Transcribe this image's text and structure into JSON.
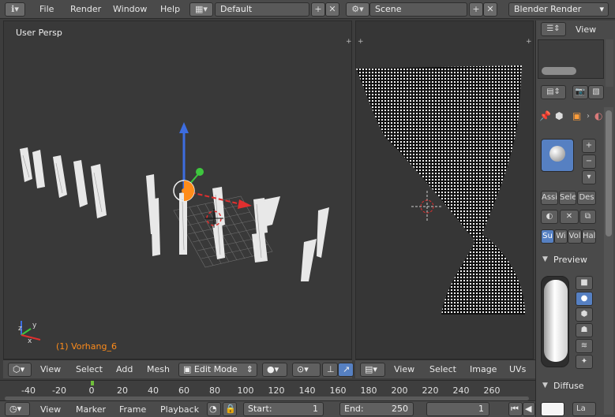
{
  "topbar": {
    "menu": [
      "File",
      "Render",
      "Window",
      "Help"
    ],
    "layout_name": "Default",
    "scene_name": "Scene",
    "render_engine": "Blender Render"
  },
  "view3d": {
    "label": "User Persp",
    "object_label": "(1) Vorhang_6",
    "header": {
      "menus": [
        "View",
        "Select",
        "Add",
        "Mesh"
      ],
      "mode": "Edit Mode"
    }
  },
  "uv_editor": {
    "header": {
      "menus": [
        "View",
        "Select",
        "Image",
        "UVs"
      ]
    }
  },
  "properties": {
    "view_label": "View",
    "buttons_row": [
      "Assi",
      "Sele",
      "Des"
    ],
    "tabs_row": [
      "Su",
      "Wi",
      "Vol",
      "Hal"
    ],
    "preview_label": "Preview",
    "diffuse_label": "Diffuse",
    "diffuse_shader": "La"
  },
  "timeline": {
    "ticks": [
      "-40",
      "-20",
      "0",
      "20",
      "40",
      "60",
      "80",
      "100",
      "120",
      "140",
      "160",
      "180",
      "200",
      "220",
      "240",
      "260"
    ],
    "current_frame": 0
  },
  "bottombar": {
    "menus": [
      "View",
      "Marker",
      "Frame",
      "Playback"
    ],
    "start_label": "Start:",
    "start_value": "1",
    "end_label": "End:",
    "end_value": "250",
    "current_value": "1"
  },
  "colors": {
    "accent": "#5680c2",
    "keyframe_marker": "#6fbf3a",
    "gizmo_x": "#e02f2f",
    "gizmo_y": "#3ec63e",
    "gizmo_z": "#3d6de0",
    "origin": "#ff8c1a"
  }
}
